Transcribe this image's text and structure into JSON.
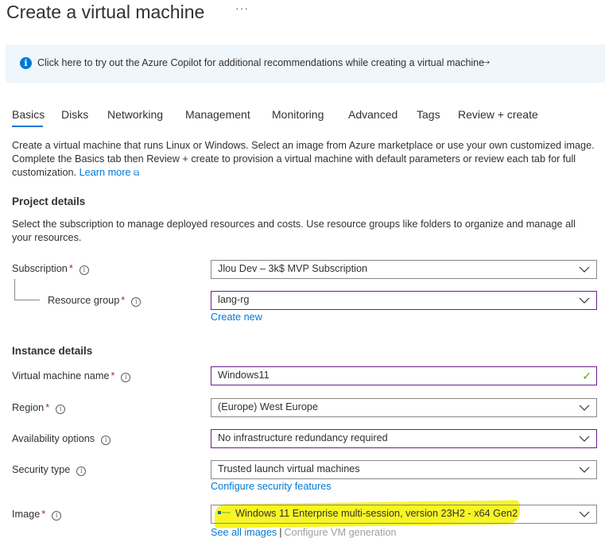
{
  "header": {
    "title": "Create a virtual machine",
    "more": "···"
  },
  "banner": {
    "text": "Click here to try out the Azure Copilot for additional recommendations while creating a virtual machine"
  },
  "tabs": [
    {
      "label": "Basics"
    },
    {
      "label": "Disks"
    },
    {
      "label": "Networking"
    },
    {
      "label": "Management"
    },
    {
      "label": "Monitoring"
    },
    {
      "label": "Advanced"
    },
    {
      "label": "Tags"
    },
    {
      "label": "Review + create"
    }
  ],
  "intro": {
    "text": "Create a virtual machine that runs Linux or Windows. Select an image from Azure marketplace or use your own customized image. Complete the Basics tab then Review + create to provision a virtual machine with default parameters or review each tab for full customization.",
    "learn_more": "Learn more"
  },
  "project": {
    "heading": "Project details",
    "desc": "Select the subscription to manage deployed resources and costs. Use resource groups like folders to organize and manage all your resources.",
    "subscription_label": "Subscription",
    "subscription_value": "Jlou Dev – 3k$ MVP Subscription",
    "rg_label": "Resource group",
    "rg_value": "lang-rg",
    "create_new": "Create new"
  },
  "instance": {
    "heading": "Instance details",
    "vm_name_label": "Virtual machine name",
    "vm_name_value": "Windows11",
    "region_label": "Region",
    "region_value": "(Europe) West Europe",
    "availability_label": "Availability options",
    "availability_value": "No infrastructure redundancy required",
    "security_label": "Security type",
    "security_value": "Trusted launch virtual machines",
    "configure_security": "Configure security features",
    "image_label": "Image",
    "image_value": "Windows 11 Enterprise multi-session, version 23H2 - x64 Gen2",
    "see_all_images": "See all images",
    "separator": "|",
    "configure_vm_generation": "Configure VM generation"
  },
  "common": {
    "required_mark": "*",
    "info_glyph": "i"
  },
  "colors": {
    "accent": "#0078d4",
    "focus_border": "#6b1f8e",
    "highlight": "#f7f41a",
    "valid": "#57a300"
  }
}
